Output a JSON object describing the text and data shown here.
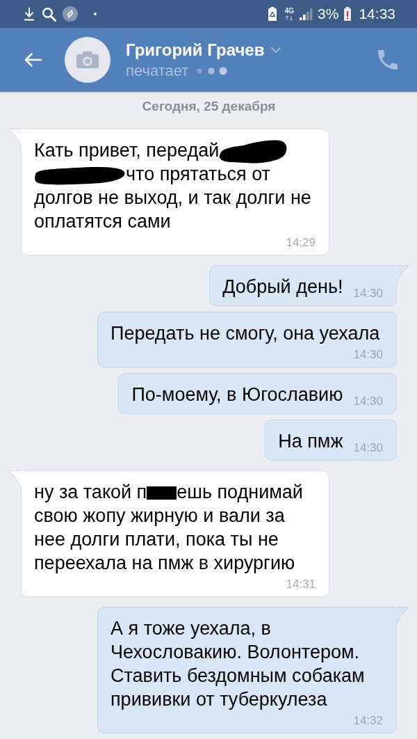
{
  "status_bar": {
    "network": "4G",
    "battery": "3%",
    "time": "14:33"
  },
  "header": {
    "name": "Григорий Грачев",
    "status": "печатает"
  },
  "date_separator": "Сегодня, 25 декабря",
  "messages": [
    {
      "kind": "incoming",
      "tail": true,
      "parts": [
        {
          "kind": "text",
          "text": "Кать привет, передай"
        },
        {
          "kind": "scribble"
        },
        {
          "kind": "long-scribble"
        },
        {
          "kind": "text",
          "text": "что прятаться от долгов не выход, и так долги не оплатятся сами"
        }
      ],
      "time": "14:29"
    },
    {
      "kind": "outgoing",
      "tail": true,
      "parts": [
        {
          "kind": "text",
          "text": "Добрый день!"
        }
      ],
      "time": "14:30"
    },
    {
      "kind": "outgoing",
      "tail": false,
      "parts": [
        {
          "kind": "text",
          "text": "Передать не смогу, она уехала"
        }
      ],
      "time": "14:30"
    },
    {
      "kind": "outgoing",
      "tail": false,
      "parts": [
        {
          "kind": "text",
          "text": "По-моему, в Югославию"
        }
      ],
      "time": "14:30"
    },
    {
      "kind": "outgoing",
      "tail": false,
      "parts": [
        {
          "kind": "text",
          "text": "На пмж"
        }
      ],
      "time": "14:30"
    },
    {
      "kind": "incoming",
      "tail": true,
      "parts": [
        {
          "kind": "text",
          "text": "ну за такой п"
        },
        {
          "kind": "block"
        },
        {
          "kind": "text",
          "text": "ешь поднимай свою жопу жирную и вали за нее долги плати, пока ты не переехала на пмж в хирургию"
        }
      ],
      "time": "14:31"
    },
    {
      "kind": "outgoing",
      "tail": true,
      "parts": [
        {
          "kind": "text",
          "text": "А я тоже уехала, в Чехословакию. Волонтером. Ставить бездомным собакам прививки от туберкулеза"
        }
      ],
      "time": "14:32"
    }
  ]
}
